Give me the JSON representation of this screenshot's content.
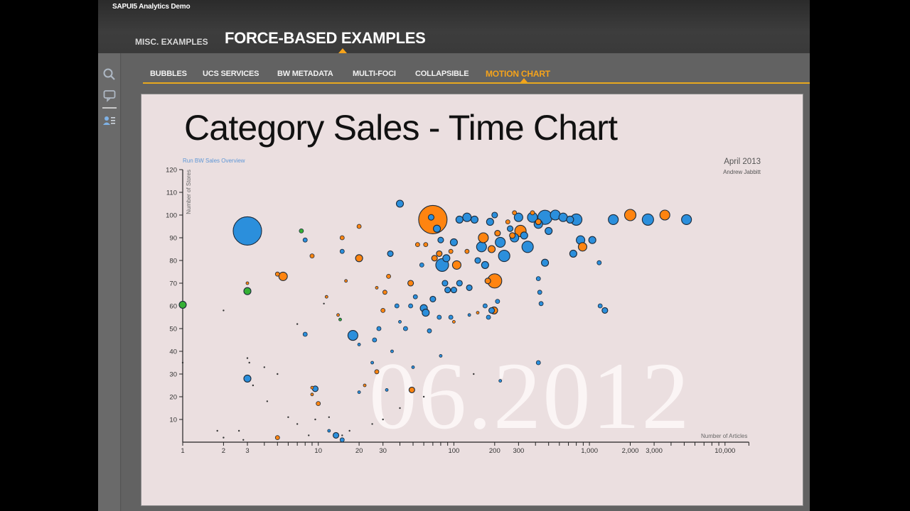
{
  "app": {
    "title": "SAPUI5 Analytics Demo",
    "main_tabs": [
      {
        "label": "MISC. EXAMPLES",
        "active": false
      },
      {
        "label": "FORCE-BASED EXAMPLES",
        "active": true
      }
    ],
    "sidebar_icons": [
      "search-icon",
      "comment-icon",
      "user-list-icon"
    ],
    "sub_tabs": [
      {
        "label": "BUBBLES",
        "active": false
      },
      {
        "label": "UCS SERVICES",
        "active": false
      },
      {
        "label": "BW METADATA",
        "active": false
      },
      {
        "label": "MULTI-FOCI",
        "active": false
      },
      {
        "label": "COLLAPSIBLE",
        "active": false
      },
      {
        "label": "MOTION CHART",
        "active": true
      }
    ],
    "accent_color": "#f5a31b"
  },
  "panel": {
    "heading": "Category Sales - Time Chart",
    "link": "Run BW Sales Overview",
    "date": "April 2013",
    "author": "Andrew Jabbitt",
    "watermark": "06.2012"
  },
  "chart_data": {
    "type": "scatter",
    "subtype": "bubble",
    "title": "Category Sales - Time Chart",
    "xlabel": "Number of Articles",
    "ylabel": "Number of Stores",
    "xscale": "log",
    "xlim": [
      1,
      15000
    ],
    "ylim": [
      0,
      120
    ],
    "x_ticks": [
      "1",
      "2",
      "3",
      "10",
      "20",
      "30",
      "100",
      "200",
      "300",
      "1,000",
      "2,000",
      "3,000",
      "10,000"
    ],
    "x_tick_values": [
      1,
      2,
      3,
      10,
      20,
      30,
      100,
      200,
      300,
      1000,
      2000,
      3000,
      10000
    ],
    "y_ticks": [
      10,
      20,
      30,
      40,
      50,
      60,
      70,
      80,
      90,
      100,
      110,
      120
    ],
    "grid": false,
    "time_label": "06.2012",
    "colors": {
      "blue": "#2b8fdc",
      "orange": "#ff8410",
      "green": "#35b035"
    },
    "series": [
      {
        "name": "blue",
        "color": "#2b8fdc",
        "points": [
          {
            "x": 3,
            "y": 93,
            "size": 20
          },
          {
            "x": 8,
            "y": 89,
            "size": 3
          },
          {
            "x": 8,
            "y": 47.5,
            "size": 3
          },
          {
            "x": 3,
            "y": 28,
            "size": 5
          },
          {
            "x": 9.5,
            "y": 23.5,
            "size": 4
          },
          {
            "x": 18,
            "y": 47,
            "size": 7
          },
          {
            "x": 15,
            "y": 84,
            "size": 3
          },
          {
            "x": 40,
            "y": 105,
            "size": 5
          },
          {
            "x": 34,
            "y": 83,
            "size": 4
          },
          {
            "x": 68,
            "y": 99,
            "size": 4
          },
          {
            "x": 75,
            "y": 94,
            "size": 5
          },
          {
            "x": 80,
            "y": 89,
            "size": 4
          },
          {
            "x": 88,
            "y": 81,
            "size": 5
          },
          {
            "x": 82,
            "y": 78,
            "size": 9
          },
          {
            "x": 86,
            "y": 70,
            "size": 4
          },
          {
            "x": 90,
            "y": 67,
            "size": 4
          },
          {
            "x": 100,
            "y": 88,
            "size": 5
          },
          {
            "x": 110,
            "y": 98,
            "size": 5
          },
          {
            "x": 125,
            "y": 99,
            "size": 6
          },
          {
            "x": 142,
            "y": 98,
            "size": 5
          },
          {
            "x": 160,
            "y": 86,
            "size": 7
          },
          {
            "x": 150,
            "y": 80,
            "size": 4
          },
          {
            "x": 170,
            "y": 78,
            "size": 5
          },
          {
            "x": 185,
            "y": 97,
            "size": 5
          },
          {
            "x": 200,
            "y": 100,
            "size": 4
          },
          {
            "x": 220,
            "y": 88,
            "size": 7
          },
          {
            "x": 235,
            "y": 82,
            "size": 8
          },
          {
            "x": 260,
            "y": 94,
            "size": 4
          },
          {
            "x": 280,
            "y": 90,
            "size": 6
          },
          {
            "x": 300,
            "y": 99,
            "size": 6
          },
          {
            "x": 330,
            "y": 91,
            "size": 5
          },
          {
            "x": 350,
            "y": 86,
            "size": 8
          },
          {
            "x": 380,
            "y": 99,
            "size": 7
          },
          {
            "x": 420,
            "y": 96,
            "size": 6
          },
          {
            "x": 470,
            "y": 99,
            "size": 10
          },
          {
            "x": 500,
            "y": 93,
            "size": 5
          },
          {
            "x": 560,
            "y": 100,
            "size": 7
          },
          {
            "x": 640,
            "y": 99,
            "size": 6
          },
          {
            "x": 720,
            "y": 98,
            "size": 5
          },
          {
            "x": 800,
            "y": 98,
            "size": 8
          },
          {
            "x": 860,
            "y": 89,
            "size": 6
          },
          {
            "x": 760,
            "y": 83,
            "size": 5
          },
          {
            "x": 1050,
            "y": 89,
            "size": 5
          },
          {
            "x": 470,
            "y": 79,
            "size": 5
          },
          {
            "x": 420,
            "y": 72,
            "size": 3
          },
          {
            "x": 430,
            "y": 66,
            "size": 3
          },
          {
            "x": 440,
            "y": 61,
            "size": 3
          },
          {
            "x": 1180,
            "y": 79,
            "size": 3
          },
          {
            "x": 1200,
            "y": 60,
            "size": 3
          },
          {
            "x": 1300,
            "y": 58,
            "size": 4
          },
          {
            "x": 1500,
            "y": 98,
            "size": 7
          },
          {
            "x": 2700,
            "y": 98,
            "size": 8
          },
          {
            "x": 5200,
            "y": 98,
            "size": 7
          },
          {
            "x": 58,
            "y": 78,
            "size": 3
          },
          {
            "x": 52,
            "y": 64,
            "size": 3
          },
          {
            "x": 48,
            "y": 60,
            "size": 3
          },
          {
            "x": 38,
            "y": 60,
            "size": 3
          },
          {
            "x": 40,
            "y": 53,
            "size": 2
          },
          {
            "x": 60,
            "y": 59,
            "size": 5
          },
          {
            "x": 62,
            "y": 57,
            "size": 5
          },
          {
            "x": 70,
            "y": 63,
            "size": 4
          },
          {
            "x": 78,
            "y": 55,
            "size": 3
          },
          {
            "x": 100,
            "y": 67,
            "size": 4
          },
          {
            "x": 110,
            "y": 70,
            "size": 4
          },
          {
            "x": 130,
            "y": 68,
            "size": 4
          },
          {
            "x": 170,
            "y": 60,
            "size": 3
          },
          {
            "x": 180,
            "y": 55,
            "size": 3
          },
          {
            "x": 190,
            "y": 58,
            "size": 4
          },
          {
            "x": 210,
            "y": 62,
            "size": 3
          },
          {
            "x": 44,
            "y": 50,
            "size": 3
          },
          {
            "x": 28,
            "y": 50,
            "size": 3
          },
          {
            "x": 26,
            "y": 45,
            "size": 3
          },
          {
            "x": 20,
            "y": 43,
            "size": 2
          },
          {
            "x": 66,
            "y": 49,
            "size": 3
          },
          {
            "x": 95,
            "y": 55,
            "size": 3
          },
          {
            "x": 130,
            "y": 56,
            "size": 2
          },
          {
            "x": 35,
            "y": 40,
            "size": 2
          },
          {
            "x": 50,
            "y": 33,
            "size": 2
          },
          {
            "x": 80,
            "y": 38,
            "size": 2
          },
          {
            "x": 420,
            "y": 35,
            "size": 3
          },
          {
            "x": 220,
            "y": 27,
            "size": 2
          },
          {
            "x": 32,
            "y": 23,
            "size": 2
          },
          {
            "x": 15,
            "y": 1,
            "size": 3
          },
          {
            "x": 12,
            "y": 5,
            "size": 2
          },
          {
            "x": 25,
            "y": 35,
            "size": 2
          },
          {
            "x": 20,
            "y": 22,
            "size": 2
          },
          {
            "x": 13.5,
            "y": 3,
            "size": 4
          }
        ]
      },
      {
        "name": "orange",
        "color": "#ff8410",
        "points": [
          {
            "x": 70,
            "y": 98,
            "size": 20
          },
          {
            "x": 3,
            "y": 70,
            "size": 2
          },
          {
            "x": 5,
            "y": 74,
            "size": 3
          },
          {
            "x": 5.5,
            "y": 73,
            "size": 6
          },
          {
            "x": 9,
            "y": 82,
            "size": 3
          },
          {
            "x": 11.5,
            "y": 64,
            "size": 2
          },
          {
            "x": 15,
            "y": 90,
            "size": 3
          },
          {
            "x": 20,
            "y": 95,
            "size": 3
          },
          {
            "x": 20,
            "y": 81,
            "size": 5
          },
          {
            "x": 14,
            "y": 56,
            "size": 2
          },
          {
            "x": 16,
            "y": 71,
            "size": 2
          },
          {
            "x": 27,
            "y": 68,
            "size": 2
          },
          {
            "x": 31,
            "y": 66,
            "size": 3
          },
          {
            "x": 33,
            "y": 73,
            "size": 3
          },
          {
            "x": 27,
            "y": 31,
            "size": 3
          },
          {
            "x": 30,
            "y": 58,
            "size": 3
          },
          {
            "x": 48,
            "y": 70,
            "size": 4
          },
          {
            "x": 54,
            "y": 87,
            "size": 3
          },
          {
            "x": 62,
            "y": 87,
            "size": 3
          },
          {
            "x": 72,
            "y": 81,
            "size": 4
          },
          {
            "x": 78,
            "y": 83,
            "size": 4
          },
          {
            "x": 95,
            "y": 84,
            "size": 3
          },
          {
            "x": 105,
            "y": 78,
            "size": 6
          },
          {
            "x": 125,
            "y": 84,
            "size": 3
          },
          {
            "x": 165,
            "y": 90,
            "size": 7
          },
          {
            "x": 190,
            "y": 85,
            "size": 5
          },
          {
            "x": 178,
            "y": 71,
            "size": 4
          },
          {
            "x": 200,
            "y": 71,
            "size": 10
          },
          {
            "x": 198,
            "y": 58,
            "size": 5
          },
          {
            "x": 210,
            "y": 92,
            "size": 4
          },
          {
            "x": 250,
            "y": 97,
            "size": 3
          },
          {
            "x": 270,
            "y": 91,
            "size": 4
          },
          {
            "x": 310,
            "y": 93,
            "size": 8
          },
          {
            "x": 280,
            "y": 101,
            "size": 3
          },
          {
            "x": 420,
            "y": 97,
            "size": 4
          },
          {
            "x": 380,
            "y": 101,
            "size": 3
          },
          {
            "x": 890,
            "y": 86,
            "size": 6
          },
          {
            "x": 2000,
            "y": 100,
            "size": 8
          },
          {
            "x": 3600,
            "y": 100,
            "size": 7
          },
          {
            "x": 9,
            "y": 21,
            "size": 2
          },
          {
            "x": 9,
            "y": 24,
            "size": 2
          },
          {
            "x": 10,
            "y": 17,
            "size": 3
          },
          {
            "x": 5,
            "y": 2,
            "size": 3
          },
          {
            "x": 49,
            "y": 23,
            "size": 4
          },
          {
            "x": 22,
            "y": 25,
            "size": 2
          },
          {
            "x": 100,
            "y": 53,
            "size": 2
          },
          {
            "x": 150,
            "y": 57,
            "size": 2
          }
        ]
      },
      {
        "name": "green",
        "color": "#35b035",
        "points": [
          {
            "x": 1,
            "y": 60.5,
            "size": 5
          },
          {
            "x": 3,
            "y": 66.5,
            "size": 5
          },
          {
            "x": 7.5,
            "y": 93,
            "size": 3
          },
          {
            "x": 14.5,
            "y": 54,
            "size": 2
          }
        ]
      }
    ],
    "small_dots": [
      {
        "x": 2,
        "y": 58
      },
      {
        "x": 7,
        "y": 52
      },
      {
        "x": 11,
        "y": 61
      },
      {
        "x": 3,
        "y": 37
      },
      {
        "x": 3.1,
        "y": 35
      },
      {
        "x": 4,
        "y": 33
      },
      {
        "x": 3.3,
        "y": 25
      },
      {
        "x": 4.2,
        "y": 18
      },
      {
        "x": 7,
        "y": 8
      },
      {
        "x": 5,
        "y": 30
      },
      {
        "x": 6,
        "y": 11
      },
      {
        "x": 2,
        "y": 2
      },
      {
        "x": 1.8,
        "y": 5
      },
      {
        "x": 2.6,
        "y": 5
      },
      {
        "x": 2.8,
        "y": 1
      },
      {
        "x": 8.5,
        "y": 3
      },
      {
        "x": 9.5,
        "y": 10
      },
      {
        "x": 12,
        "y": 11
      },
      {
        "x": 15,
        "y": 3
      },
      {
        "x": 17,
        "y": 5
      },
      {
        "x": 25,
        "y": 8
      },
      {
        "x": 30,
        "y": 10
      },
      {
        "x": 40,
        "y": 15
      },
      {
        "x": 60,
        "y": 20
      },
      {
        "x": 140,
        "y": 30
      },
      {
        "x": 1,
        "y": 35
      }
    ]
  }
}
